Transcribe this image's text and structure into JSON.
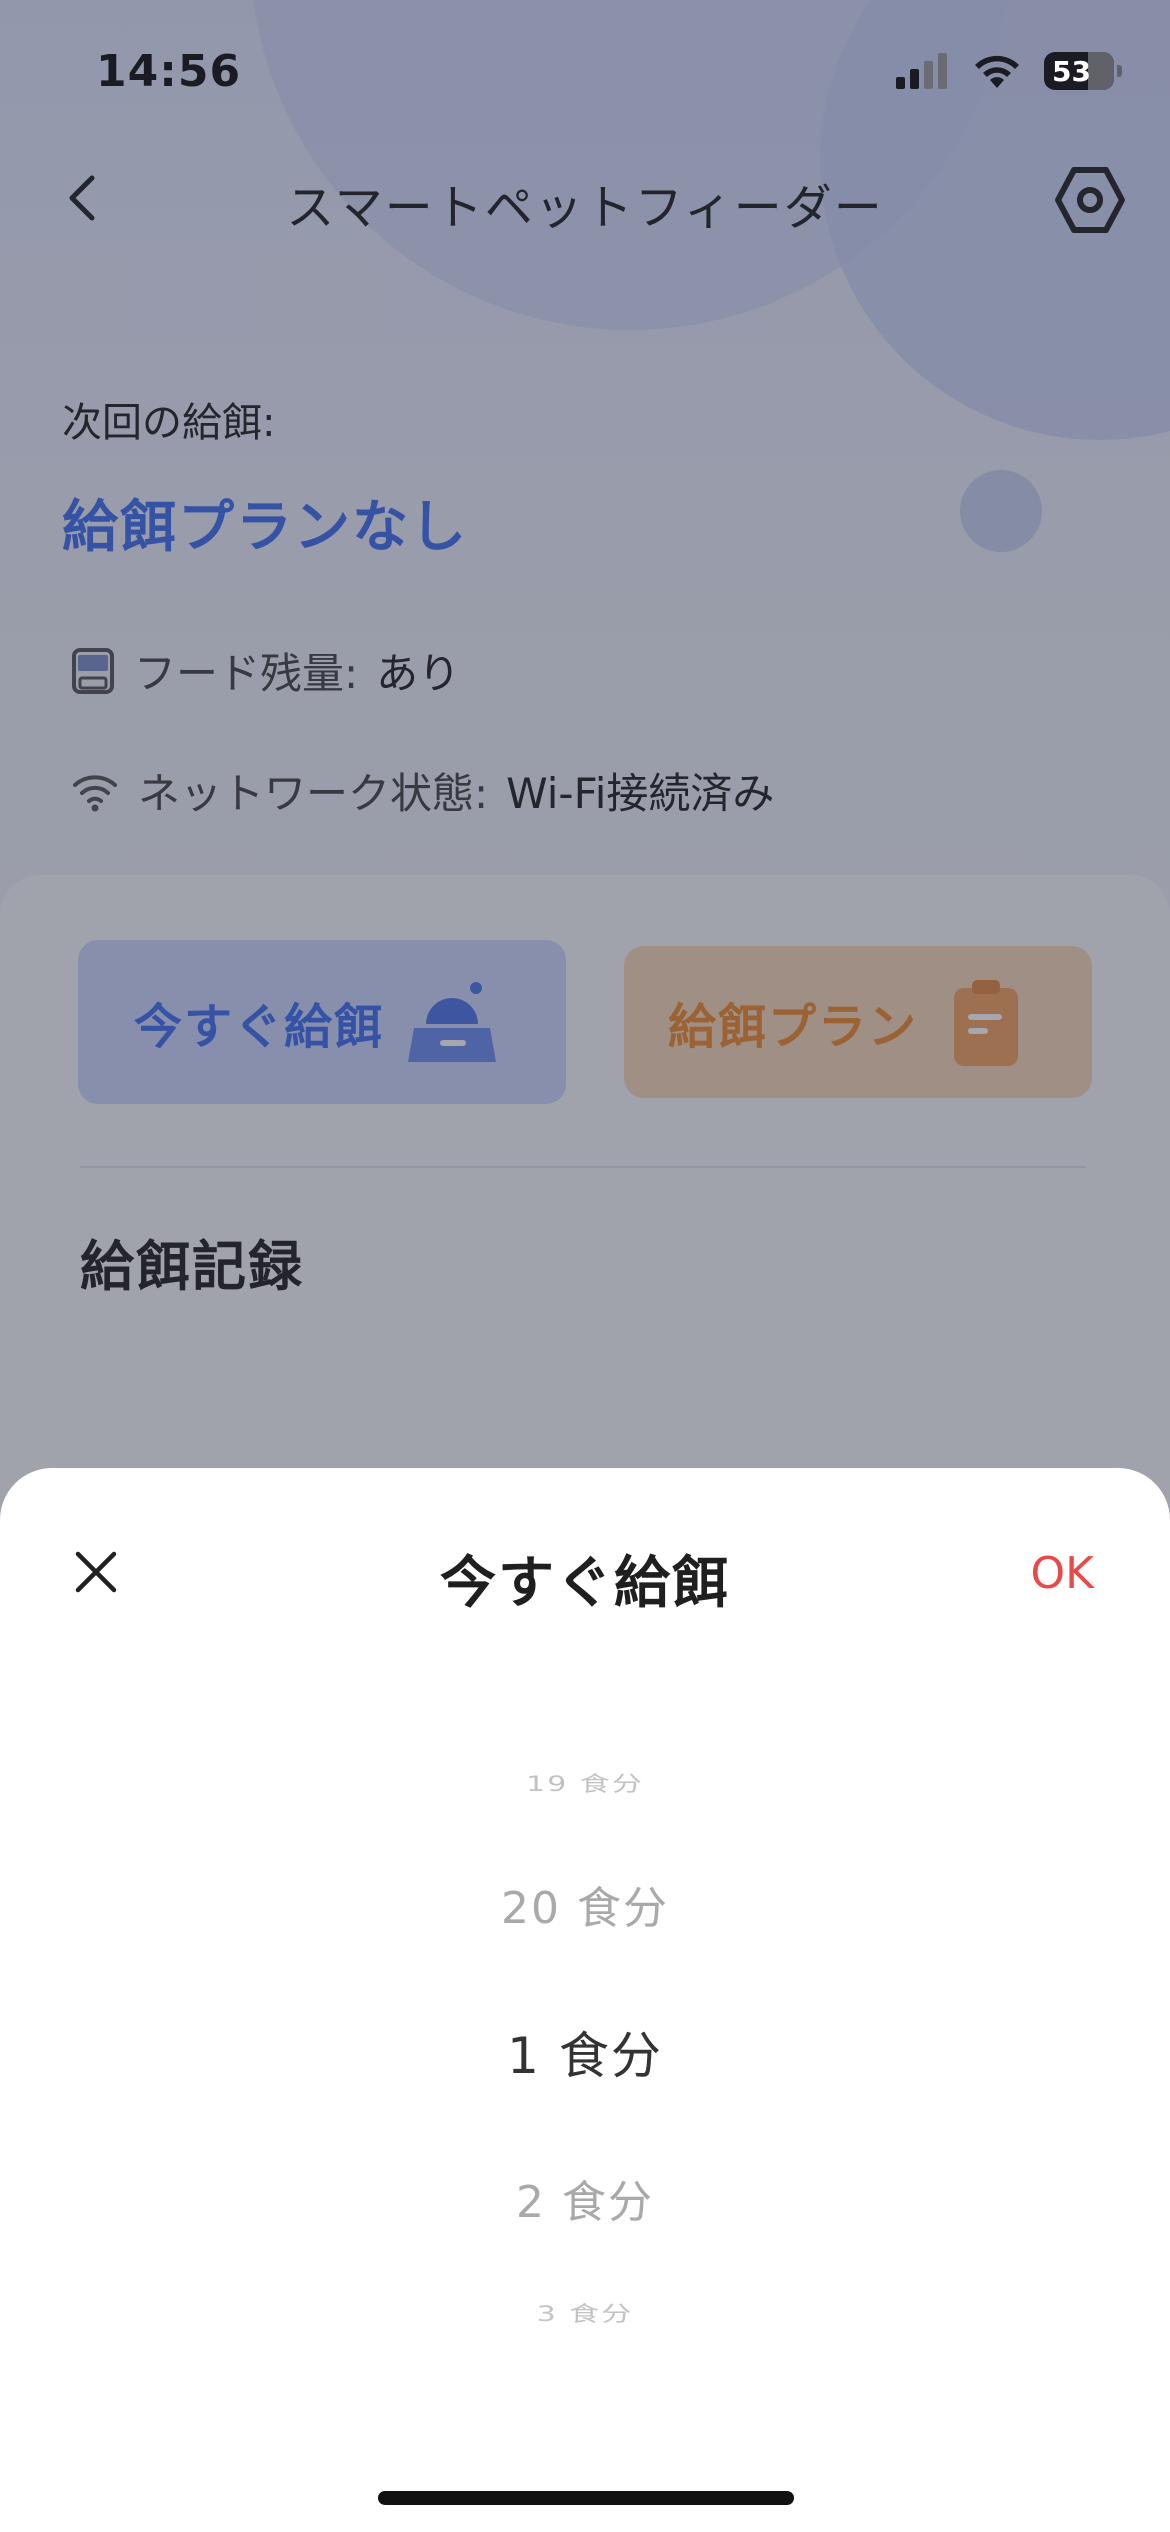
{
  "status_bar": {
    "time": "14:56",
    "battery": "53"
  },
  "nav": {
    "title": "スマートペットフィーダー",
    "back_icon": "chevron-left-icon",
    "settings_icon": "hexagon-settings-icon"
  },
  "next_feeding": {
    "label": "次回の給餌:",
    "value": "給餌プランなし"
  },
  "info": {
    "food": {
      "label": "フード残量:",
      "value": "あり",
      "icon": "food-container-icon"
    },
    "network": {
      "label": "ネットワーク状態:",
      "value": "Wi-Fi接続済み",
      "icon": "wifi-icon"
    }
  },
  "actions": {
    "feed_now": "今すぐ給餌",
    "feed_plan": "給餌プラン"
  },
  "records": {
    "title": "給餌記録"
  },
  "sheet": {
    "title": "今すぐ給餌",
    "ok": "OK",
    "picker": {
      "far_above": "19 食分",
      "above": "20 食分",
      "selected": "1 食分",
      "below": "2 食分",
      "far_below": "3 食分"
    }
  },
  "colors": {
    "accent_blue": "#3e6ff0",
    "accent_orange": "#ee8a2c",
    "ok_red": "#e84a4a"
  }
}
